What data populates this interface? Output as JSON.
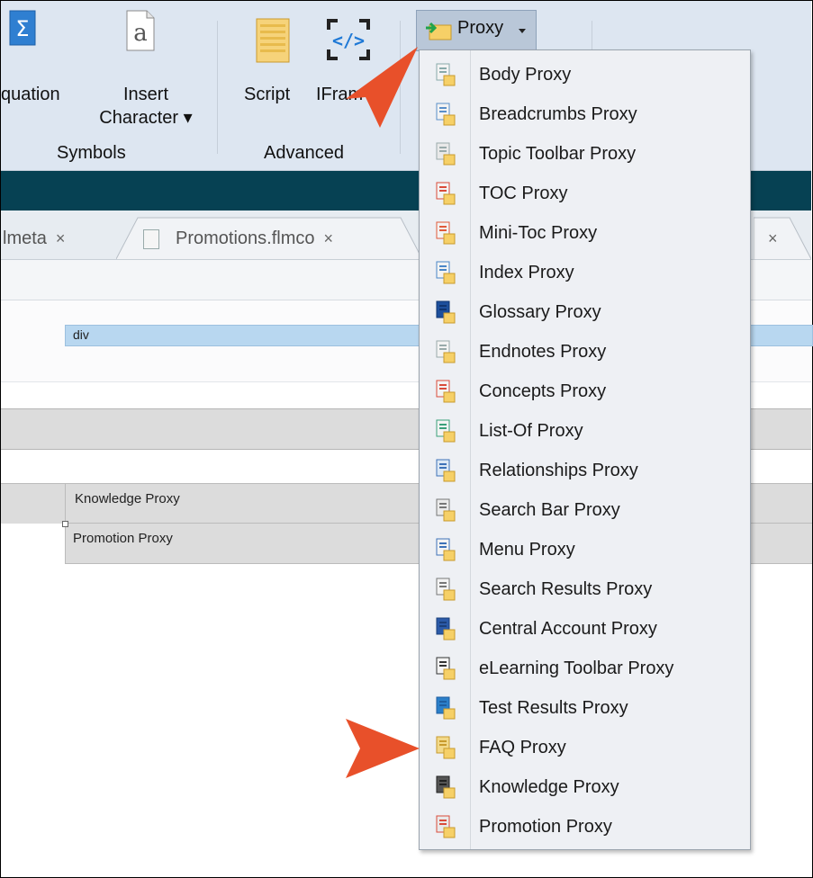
{
  "ribbon": {
    "equation_label": "quation",
    "insert_char_line1": "Insert",
    "insert_char_line2": "Character ▾",
    "script_label": "Script",
    "iframe_label": "IFram",
    "symbols_group": "Symbols",
    "advanced_group": "Advanced",
    "proxy_button": "Proxy"
  },
  "tabs": [
    {
      "label": "lmeta",
      "close": "×"
    },
    {
      "label": "Promotions.flmco",
      "close": "×"
    },
    {
      "label": "",
      "close": "×"
    }
  ],
  "editor": {
    "div_label": "div",
    "knowledge_block": "Knowledge Proxy",
    "promotion_block": "Promotion Proxy"
  },
  "proxy_menu": [
    {
      "label": "Body Proxy",
      "icon": "body-proxy-icon"
    },
    {
      "label": "Breadcrumbs Proxy",
      "icon": "breadcrumbs-proxy-icon"
    },
    {
      "label": "Topic Toolbar Proxy",
      "icon": "topic-toolbar-proxy-icon"
    },
    {
      "label": "TOC Proxy",
      "icon": "toc-proxy-icon"
    },
    {
      "label": "Mini-Toc Proxy",
      "icon": "mini-toc-proxy-icon"
    },
    {
      "label": "Index Proxy",
      "icon": "index-proxy-icon"
    },
    {
      "label": "Glossary Proxy",
      "icon": "glossary-proxy-icon"
    },
    {
      "label": "Endnotes Proxy",
      "icon": "endnotes-proxy-icon"
    },
    {
      "label": "Concepts Proxy",
      "icon": "concepts-proxy-icon"
    },
    {
      "label": "List-Of Proxy",
      "icon": "list-of-proxy-icon"
    },
    {
      "label": "Relationships Proxy",
      "icon": "relationships-proxy-icon"
    },
    {
      "label": "Search Bar Proxy",
      "icon": "search-bar-proxy-icon"
    },
    {
      "label": "Menu Proxy",
      "icon": "menu-proxy-icon"
    },
    {
      "label": "Search Results Proxy",
      "icon": "search-results-proxy-icon"
    },
    {
      "label": "Central Account Proxy",
      "icon": "central-account-proxy-icon"
    },
    {
      "label": "eLearning Toolbar Proxy",
      "icon": "elearning-toolbar-proxy-icon"
    },
    {
      "label": "Test Results Proxy",
      "icon": "test-results-proxy-icon"
    },
    {
      "label": "FAQ Proxy",
      "icon": "faq-proxy-icon"
    },
    {
      "label": "Knowledge Proxy",
      "icon": "knowledge-proxy-icon"
    },
    {
      "label": "Promotion Proxy",
      "icon": "promotion-proxy-icon"
    }
  ],
  "colors": {
    "ribbon_bg": "#dde6f1",
    "dark_bar": "#064153",
    "menu_bg": "#eef0f4",
    "highlight_arrow": "#e8502a",
    "div_bar": "#b8d7f0"
  }
}
